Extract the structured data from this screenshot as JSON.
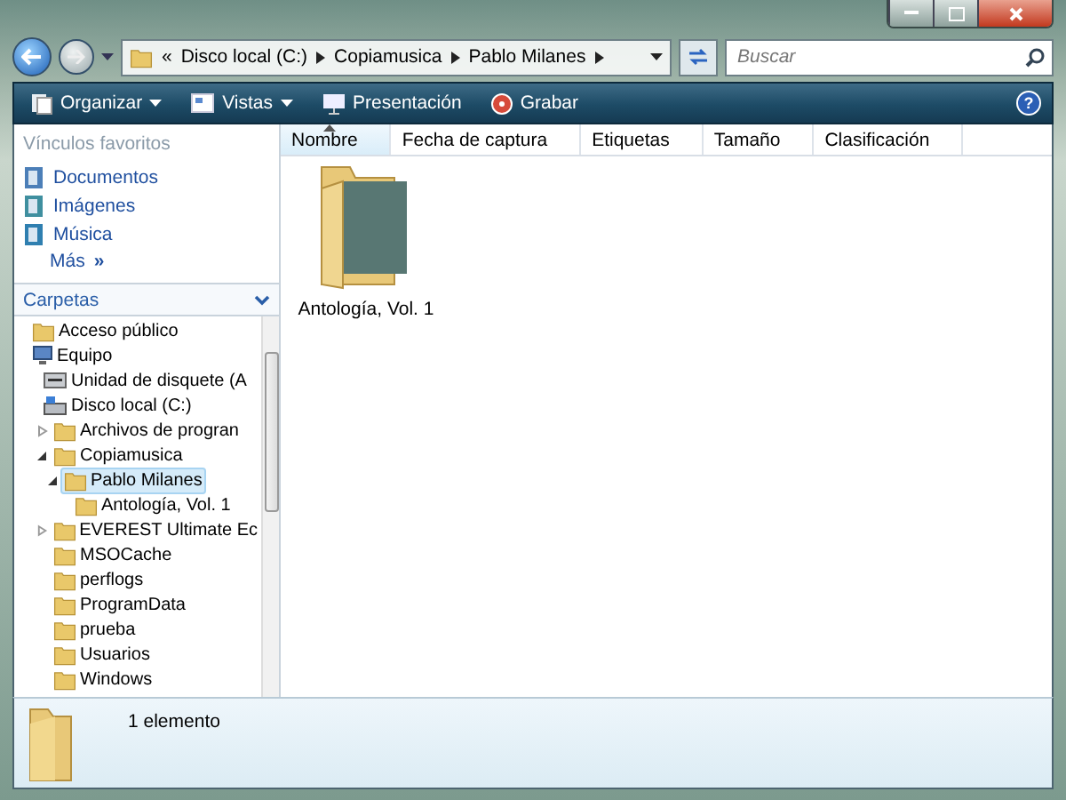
{
  "address": {
    "overflow": "«",
    "crumbs": [
      "Disco local (C:)",
      "Copiamusica",
      "Pablo Milanes"
    ]
  },
  "search": {
    "placeholder": "Buscar"
  },
  "toolbar": {
    "items": [
      {
        "label": "Organizar",
        "kind": "organize",
        "dropdown": true
      },
      {
        "label": "Vistas",
        "kind": "views",
        "dropdown": true
      },
      {
        "label": "Presentación",
        "kind": "slideshow",
        "dropdown": false
      },
      {
        "label": "Grabar",
        "kind": "burn",
        "dropdown": false
      }
    ],
    "help": "?"
  },
  "favorites": {
    "title": "Vínculos favoritos",
    "items": [
      {
        "label": "Documentos",
        "kind": "documents"
      },
      {
        "label": "Imágenes",
        "kind": "pictures"
      },
      {
        "label": "Música",
        "kind": "music"
      }
    ],
    "more": {
      "label": "Más",
      "glyph": "»"
    }
  },
  "folders": {
    "title": "Carpetas",
    "expanded": true,
    "tree": [
      {
        "label": "Acceso público",
        "kind": "folder",
        "has_children": false,
        "selected": false
      },
      {
        "label": "Equipo",
        "kind": "computer",
        "has_children": false,
        "selected": false,
        "children": [
          {
            "label": "Unidad de disquete (A",
            "kind": "floppy",
            "has_children": false,
            "selected": false
          },
          {
            "label": "Disco local (C:)",
            "kind": "drive",
            "has_children": false,
            "selected": false,
            "children": [
              {
                "label": "Archivos de progran",
                "kind": "folder",
                "has_children": true,
                "expanded": false,
                "selected": false
              },
              {
                "label": "Copiamusica",
                "kind": "folder",
                "has_children": true,
                "expanded": true,
                "selected": false,
                "children": [
                  {
                    "label": "Pablo Milanes",
                    "kind": "folder",
                    "has_children": true,
                    "expanded": true,
                    "selected": true,
                    "children": [
                      {
                        "label": "Antología, Vol. 1",
                        "kind": "folder",
                        "has_children": false,
                        "selected": false
                      }
                    ]
                  }
                ]
              },
              {
                "label": "EVEREST Ultimate Ec",
                "kind": "folder",
                "has_children": true,
                "expanded": false,
                "selected": false
              },
              {
                "label": "MSOCache",
                "kind": "folder",
                "has_children": false,
                "selected": false
              },
              {
                "label": "perflogs",
                "kind": "folder",
                "has_children": false,
                "selected": false
              },
              {
                "label": "ProgramData",
                "kind": "folder",
                "has_children": false,
                "selected": false
              },
              {
                "label": "prueba",
                "kind": "folder",
                "has_children": false,
                "selected": false
              },
              {
                "label": "Usuarios",
                "kind": "folder",
                "has_children": false,
                "selected": false
              },
              {
                "label": "Windows",
                "kind": "folder",
                "has_children": false,
                "selected": false
              }
            ]
          }
        ]
      }
    ]
  },
  "columns": [
    {
      "label": "Nombre",
      "sorted": true
    },
    {
      "label": "Fecha de captura",
      "sorted": false
    },
    {
      "label": "Etiquetas",
      "sorted": false
    },
    {
      "label": "Tamaño",
      "sorted": false
    },
    {
      "label": "Clasificación",
      "sorted": false
    }
  ],
  "files": [
    {
      "name": "Antología, Vol. 1",
      "kind": "photo-folder"
    }
  ],
  "details": {
    "count": "1 elemento"
  }
}
